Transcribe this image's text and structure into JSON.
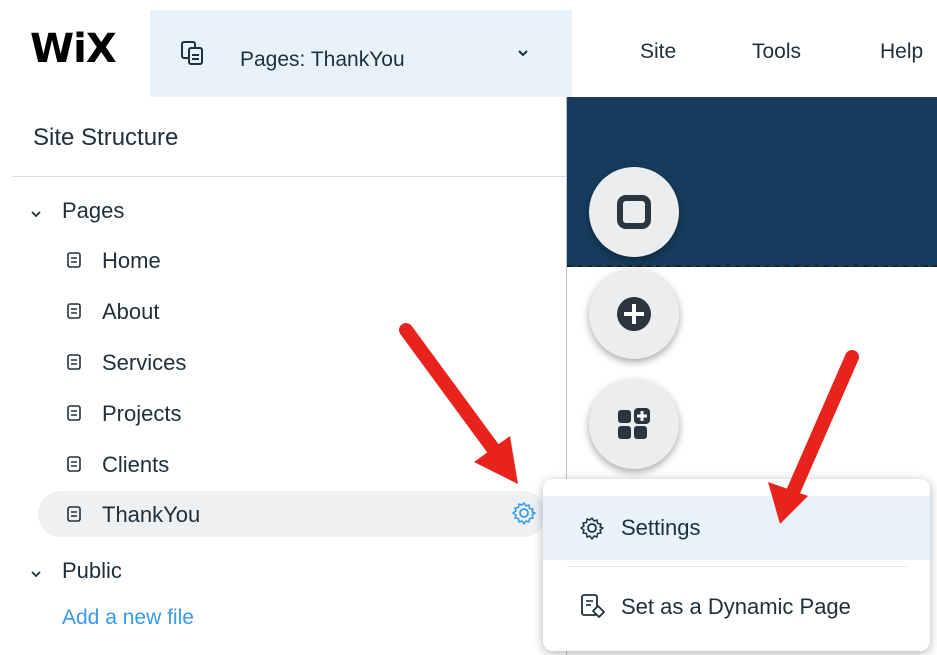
{
  "header": {
    "logo": "WiX",
    "page_selector_label": "Pages: ThankYou",
    "menu": [
      "Site",
      "Tools",
      "Help"
    ]
  },
  "sidebar": {
    "title": "Site Structure",
    "pages_group": "Pages",
    "pages": [
      "Home",
      "About",
      "Services",
      "Projects",
      "Clients",
      "ThankYou"
    ],
    "public_group": "Public",
    "add_file_link": "Add a new file"
  },
  "context_menu": {
    "settings": "Settings",
    "dynamic_page": "Set as a Dynamic Page"
  },
  "colors": {
    "header_blue": "#163c5d",
    "link_blue": "#3899ec",
    "highlight": "#e7f2fb",
    "arrow_red": "#e8231e"
  },
  "icons": [
    "pages-icon",
    "chevron-down-icon",
    "page-icon",
    "gear-icon",
    "add-icon",
    "add-apps-icon",
    "dynamic-page-icon"
  ]
}
